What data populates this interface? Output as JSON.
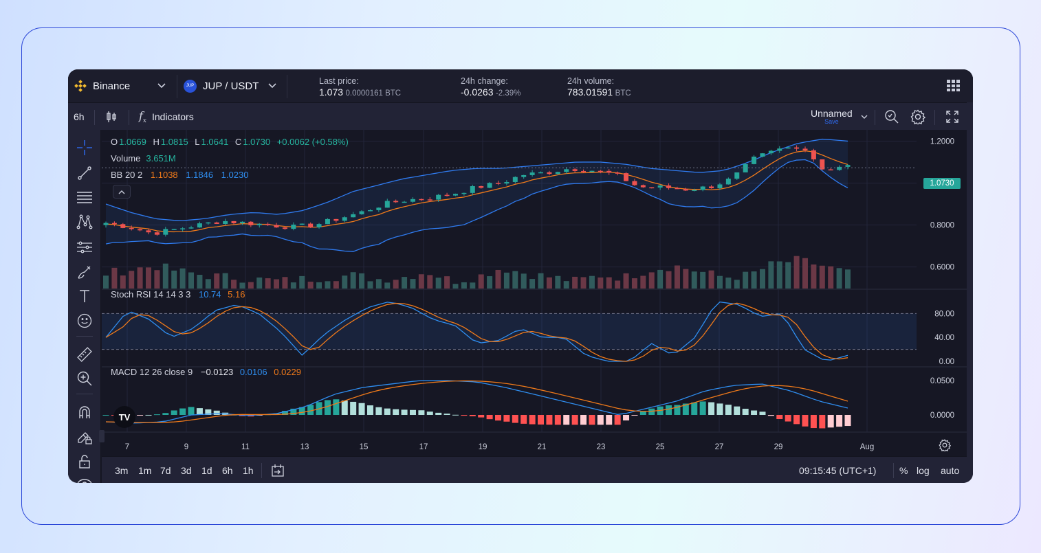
{
  "topbar": {
    "exchange": "Binance",
    "pair": "JUP / USDT",
    "pair_badge": "JUP",
    "last_price_label": "Last price:",
    "last_price": "1.073",
    "last_price_btc": "0.0000161 BTC",
    "change_label": "24h change:",
    "change_value": "-0.0263",
    "change_pct": "-2.39%",
    "volume_label": "24h volume:",
    "volume_value": "783.01591",
    "volume_unit": "BTC",
    "icons": [
      "binance-logo-icon",
      "chevron-down-icon",
      "grid-menu-icon"
    ]
  },
  "toolbar": {
    "interval": "6h",
    "indicators_label": "Indicators",
    "layout_name": "Unnamed",
    "save_label": "Save",
    "icons": [
      "candles-icon",
      "fx-icon",
      "chevron-down-icon",
      "quick-search-icon",
      "settings-icon",
      "fullscreen-icon"
    ]
  },
  "left_tools": [
    "crosshair-icon",
    "trend-line-icon",
    "fib-lines-icon",
    "pattern-icon",
    "prediction-icon",
    "brush-icon",
    "text-icon",
    "emoji-icon",
    "ruler-icon",
    "zoom-in-icon",
    "magnet-icon",
    "lock-draw-icon",
    "unlock-icon"
  ],
  "legend": {
    "ohlc": {
      "o_label": "O",
      "o": "1.0669",
      "h_label": "H",
      "h": "1.0815",
      "l_label": "L",
      "l": "1.0641",
      "c_label": "C",
      "c": "1.0730",
      "change": "+0.0062 (+0.58%)"
    },
    "volume_label": "Volume",
    "volume": "3.651M",
    "bb_label": "BB 20 2",
    "bb_basis": "1.1038",
    "bb_upper": "1.1846",
    "bb_lower": "1.0230",
    "stoch_label": "Stoch RSI 14 14 3 3",
    "stoch_k": "10.74",
    "stoch_d": "5.16",
    "macd_label": "MACD 12 26 close 9",
    "macd_hist": "−0.0123",
    "macd_line": "0.0106",
    "macd_signal": "0.0229"
  },
  "price_axis": [
    "1.2000",
    "1.0000",
    "0.8000",
    "0.6000"
  ],
  "current_price_tag": "1.0730",
  "stoch_axis": [
    "80.00",
    "40.00",
    "0.00"
  ],
  "macd_axis": [
    "0.0500",
    "0.0000"
  ],
  "time_axis": [
    "7",
    "9",
    "11",
    "13",
    "15",
    "17",
    "19",
    "21",
    "23",
    "25",
    "27",
    "29",
    "Aug"
  ],
  "bottombar": {
    "ranges": [
      "3m",
      "1m",
      "7d",
      "3d",
      "1d",
      "6h",
      "1h"
    ],
    "clock": "09:15:45 (UTC+1)",
    "pct": "%",
    "log": "log",
    "auto": "auto",
    "tv_logo_text": "TV"
  },
  "colors": {
    "up": "#26a69a",
    "down": "#ef5350",
    "bb_band": "#2f7bf0",
    "bb_basis": "#f07a1a",
    "stoch_k": "#2f8ef0",
    "stoch_d": "#f07a1a"
  },
  "chart_data": {
    "type": "candlestick",
    "title": "JUP / USDT",
    "x_ticks": [
      "7",
      "9",
      "11",
      "13",
      "15",
      "17",
      "19",
      "21",
      "23",
      "25",
      "27",
      "29",
      "Aug"
    ],
    "ylim": [
      0.52,
      1.28
    ],
    "price_close_anchors": [
      0.81,
      0.79,
      0.76,
      0.78,
      0.8,
      0.82,
      0.81,
      0.8,
      0.79,
      0.8,
      0.83,
      0.86,
      0.9,
      0.92,
      0.93,
      0.95,
      0.98,
      1.0,
      1.04,
      1.05,
      1.07,
      1.06,
      1.04,
      0.98,
      0.98,
      0.97,
      0.98,
      1.02,
      1.12,
      1.16,
      1.18,
      1.06,
      1.08
    ],
    "bb_upper_anchors": [
      0.9,
      0.86,
      0.83,
      0.82,
      0.83,
      0.85,
      0.86,
      0.85,
      0.87,
      0.91,
      0.96,
      0.99,
      1.02,
      1.04,
      1.06,
      1.07,
      1.07,
      1.08,
      1.09,
      1.1,
      1.1,
      1.09,
      1.07,
      1.06,
      1.05,
      1.06,
      1.1,
      1.15,
      1.19,
      1.21,
      1.2
    ],
    "stoch_k_anchors": [
      40,
      85,
      70,
      40,
      55,
      85,
      95,
      80,
      50,
      10,
      45,
      70,
      90,
      100,
      90,
      70,
      60,
      30,
      35,
      55,
      40,
      40,
      10,
      0,
      0,
      30,
      10,
      40,
      100,
      95,
      75,
      80,
      20,
      0,
      10
    ],
    "macd_line_anchors": [
      -0.01,
      -0.012,
      -0.01,
      0.0,
      0.002,
      -0.001,
      0.002,
      0.012,
      0.03,
      0.04,
      0.045,
      0.05,
      0.05,
      0.048,
      0.04,
      0.03,
      0.02,
      0.01,
      0.0,
      0.01,
      0.02,
      0.035,
      0.043,
      0.045,
      0.035,
      0.02,
      0.01
    ],
    "volume_anchors": [
      0.4,
      0.5,
      0.6,
      0.45,
      0.35,
      0.3,
      0.25,
      0.2,
      0.25,
      0.3,
      0.35,
      0.25,
      0.3,
      0.45,
      0.2,
      0.3,
      0.55,
      0.4,
      0.3,
      0.2,
      0.35,
      0.3,
      0.5,
      0.6,
      0.45,
      0.3,
      0.35,
      0.65,
      0.75,
      0.6,
      0.4
    ]
  }
}
